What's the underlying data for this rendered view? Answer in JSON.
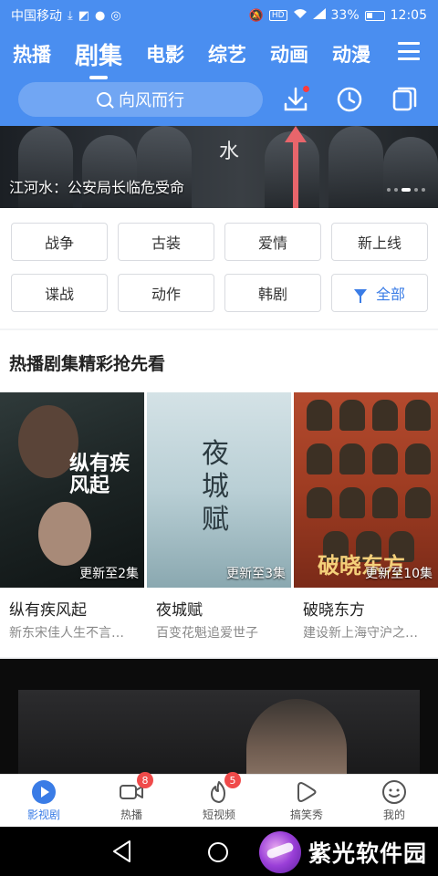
{
  "status_bar": {
    "carrier": "中国移动",
    "battery": "33%",
    "time": "12:05",
    "icons": [
      "download-icon",
      "app-icon",
      "chat-icon",
      "wechat-icon",
      "mute-icon",
      "hd-icon",
      "wifi-icon",
      "signal-icon",
      "battery-icon"
    ],
    "hd": "HD"
  },
  "header": {
    "tabs": [
      {
        "label": "热播"
      },
      {
        "label": "剧集"
      },
      {
        "label": "电影"
      },
      {
        "label": "综艺"
      },
      {
        "label": "动画"
      },
      {
        "label": "动漫"
      }
    ],
    "active_tab": "剧集",
    "search_placeholder": "向风而行",
    "icons": [
      "download-icon",
      "history-icon",
      "windows-icon",
      "menu-icon"
    ],
    "accent_color": "#4a8ef0"
  },
  "banner": {
    "title": "江河水：公安局长临危受命",
    "poster_text": "水"
  },
  "categories": [
    {
      "label": "战争"
    },
    {
      "label": "古装"
    },
    {
      "label": "爱情"
    },
    {
      "label": "新上线"
    },
    {
      "label": "谍战"
    },
    {
      "label": "动作"
    },
    {
      "label": "韩剧"
    },
    {
      "label": "全部",
      "icon": "filter-icon"
    }
  ],
  "section": {
    "title": "热播剧集精彩抢先看",
    "cards": [
      {
        "name": "纵有疾风起",
        "desc": "新东宋佳人生不言…",
        "update": "更新至2集",
        "poster_title": "纵有疾风起"
      },
      {
        "name": "夜城赋",
        "desc": "百变花魁追爱世子",
        "update": "更新至3集",
        "poster_title": "夜城赋"
      },
      {
        "name": "破晓东方",
        "desc": "建设新上海守沪之…",
        "update": "更新至10集",
        "poster_title": "破晓东方"
      }
    ]
  },
  "bottom_nav": [
    {
      "label": "影视剧",
      "icon": "play-circle-icon",
      "badge": ""
    },
    {
      "label": "热播",
      "icon": "video-camera-icon",
      "badge": "8"
    },
    {
      "label": "短视频",
      "icon": "flame-icon",
      "badge": "5"
    },
    {
      "label": "搞笑秀",
      "icon": "play-outline-icon",
      "badge": ""
    },
    {
      "label": "我的",
      "icon": "smiley-icon",
      "badge": ""
    }
  ],
  "watermark": {
    "text": "紫光软件园"
  }
}
